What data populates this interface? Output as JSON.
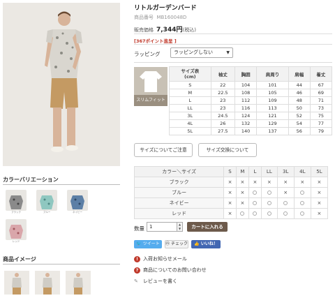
{
  "product": {
    "title": "リトルガーデンバード",
    "code_label": "商品番号",
    "code": "MB160048D",
    "price_label": "販売価格",
    "price": "7,344円",
    "tax": "(税込)",
    "points": "[367ポイント進呈 ]"
  },
  "wrapping": {
    "label": "ラッピング",
    "selected": "ラッピングしない"
  },
  "size_icon_label": "スリムフィット",
  "size_table": {
    "headers": [
      "サイズ表",
      "(cm)",
      "袖丈",
      "胸囲",
      "肩周り",
      "肩幅",
      "着丈"
    ],
    "rows": [
      [
        "S",
        "22",
        "104",
        "101",
        "44",
        "67"
      ],
      [
        "M",
        "22.5",
        "108",
        "105",
        "46",
        "69"
      ],
      [
        "L",
        "23",
        "112",
        "109",
        "48",
        "71"
      ],
      [
        "LL",
        "23",
        "116",
        "113",
        "50",
        "73"
      ],
      [
        "3L",
        "24.5",
        "124",
        "121",
        "52",
        "75"
      ],
      [
        "4L",
        "26",
        "132",
        "129",
        "54",
        "77"
      ],
      [
        "5L",
        "27.5",
        "140",
        "137",
        "56",
        "79"
      ]
    ]
  },
  "buttons": {
    "size_note": "サイズについてご注意",
    "size_exchange": "サイズ交換について",
    "cart": "カートに入れる"
  },
  "stock_table": {
    "corner": "カラー＼サイズ",
    "sizes": [
      "S",
      "M",
      "L",
      "LL",
      "3L",
      "4L",
      "5L"
    ],
    "rows": [
      {
        "color": "ブラック",
        "cells": [
          "×",
          "×",
          "×",
          "×",
          "×",
          "×",
          "×"
        ]
      },
      {
        "color": "ブルー",
        "cells": [
          "×",
          "×",
          "○",
          "○",
          "×",
          "○",
          "×"
        ]
      },
      {
        "color": "ネイビー",
        "cells": [
          "×",
          "×",
          "○",
          "○",
          "○",
          "○",
          "×"
        ]
      },
      {
        "color": "レッド",
        "cells": [
          "×",
          "○",
          "○",
          "○",
          "○",
          "○",
          "×"
        ]
      }
    ]
  },
  "quantity": {
    "label": "数量",
    "value": "1"
  },
  "social": {
    "tweet": "ツイート",
    "check": "チェック",
    "like": "いいね！"
  },
  "links": {
    "arrival": "入荷お知らせメール",
    "inquiry": "商品についてのお問い合わせ",
    "review": "レビューを書く"
  },
  "sections": {
    "color_variation": "カラーバリエーション",
    "images": "商品イメージ"
  },
  "swatches": [
    {
      "name": "ブラック",
      "color": "#8a8a8a"
    },
    {
      "name": "ブルー",
      "color": "#8fc7c0"
    },
    {
      "name": "ネイビー",
      "color": "#5c7fa6"
    },
    {
      "name": "レッド",
      "color": "#d9a6aa"
    }
  ]
}
